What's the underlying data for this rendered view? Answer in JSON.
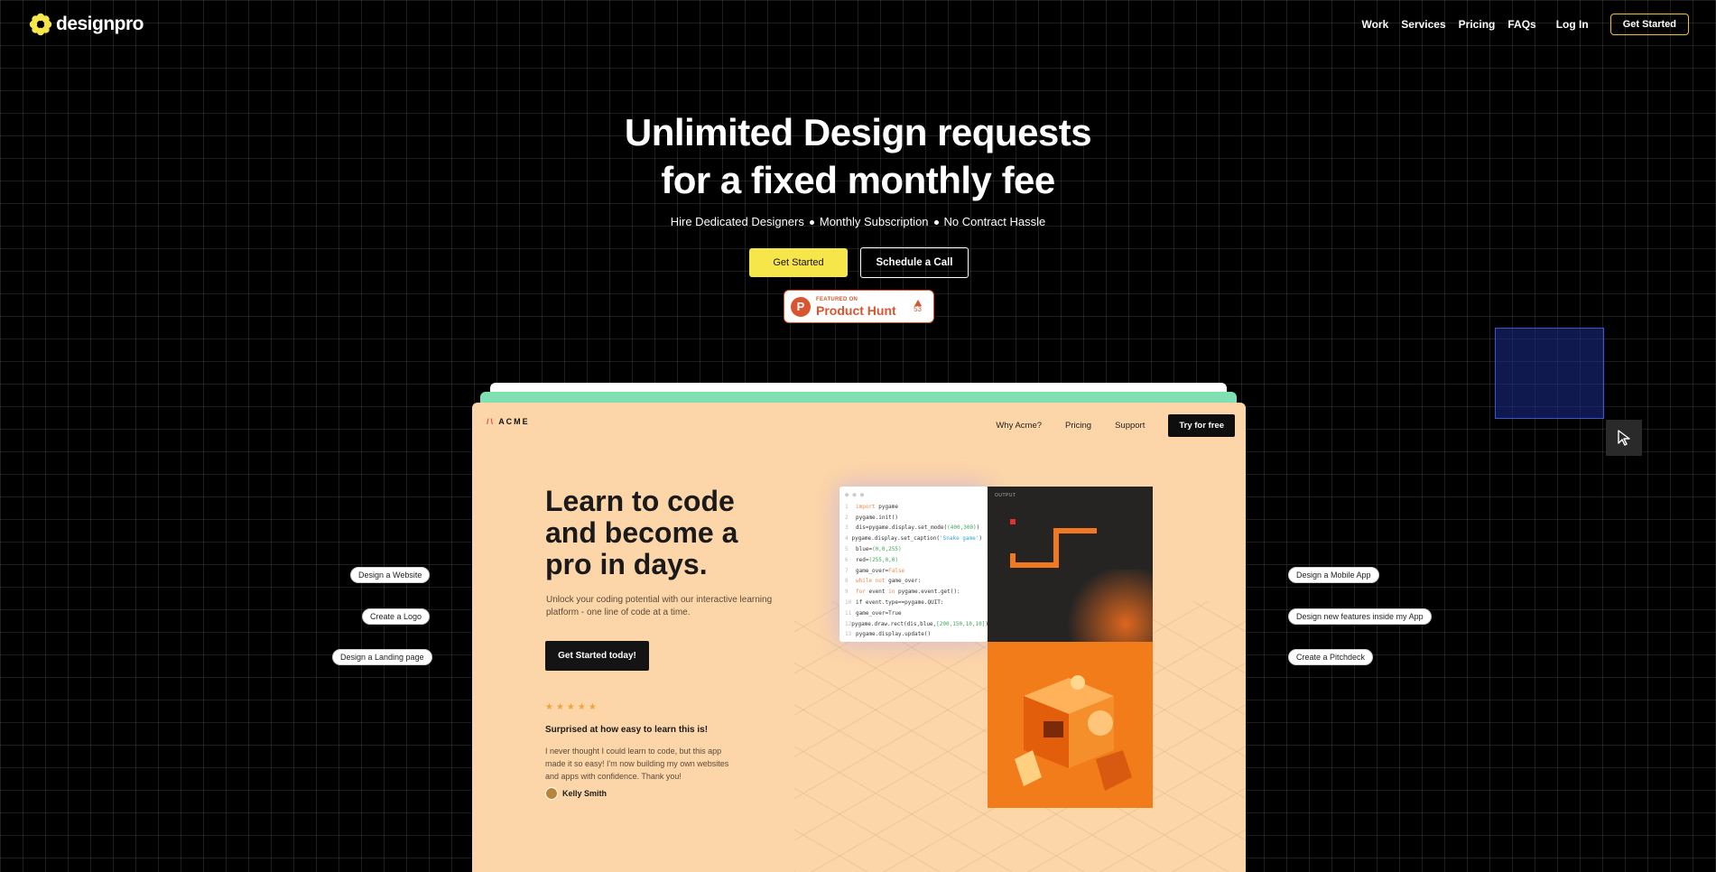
{
  "nav": {
    "brand": "designpro",
    "links": [
      "Work",
      "Services",
      "Pricing",
      "FAQs"
    ],
    "login": "Log In",
    "cta": "Get Started"
  },
  "hero": {
    "title_line1": "Unlimited Design requests",
    "title_line2": "for a fixed monthly fee",
    "sub": [
      "Hire Dedicated Designers",
      "Monthly Subscription",
      "No Contract Hassle"
    ],
    "primary_btn": "Get Started",
    "secondary_btn": "Schedule a Call"
  },
  "product_hunt": {
    "small": "FEATURED ON",
    "big": "Product Hunt",
    "votes": "53",
    "logo_letter": "P"
  },
  "pills_left": [
    "Design a Website",
    "Create a Logo",
    "Design a Landing page"
  ],
  "pills_right": [
    "Design a Mobile App",
    "Design new features inside my App",
    "Create a Pitchdeck"
  ],
  "preview": {
    "brand": "ACME",
    "nav": [
      "Why Acme?",
      "Pricing",
      "Support"
    ],
    "nav_cta": "Try for free",
    "title": "Learn to code and become a pro in days.",
    "desc": "Unlock your coding potential with our interactive learning platform - one line of code at a time.",
    "cta": "Get Started today!",
    "stars": "★★★★★",
    "review_title": "Surprised at how easy to learn this is!",
    "review_text": "I never thought I could learn to code, but this app made it so easy! I'm now building my own websites and apps with confidence. Thank you!",
    "reviewer": "Kelly Smith",
    "output_label": "OUTPUT",
    "code_lines": [
      "import pygame",
      "pygame.init()",
      "dis=pygame.display.set_mode((400,300))",
      "pygame.display.set_caption('Snake game')",
      "blue=(0,0,255)",
      "red=(255,0,0)",
      "game_over=False",
      "while not game_over:",
      "for event in pygame.event.get():",
      "if event.type==pygame.QUIT:",
      "game_over=True",
      "pygame.draw.rect(dis,blue,[200,150,10,10])",
      "pygame.display.update()"
    ]
  },
  "colors": {
    "accent_yellow": "#f7e64a",
    "card_bg": "#fcd6a8",
    "ph_orange": "#da552f",
    "selection_blue": "#3b55d8"
  },
  "icons": {
    "logo": "flower-logo-icon",
    "cursor": "cursor-arrow-icon",
    "upvote": "triangle-up-icon"
  }
}
